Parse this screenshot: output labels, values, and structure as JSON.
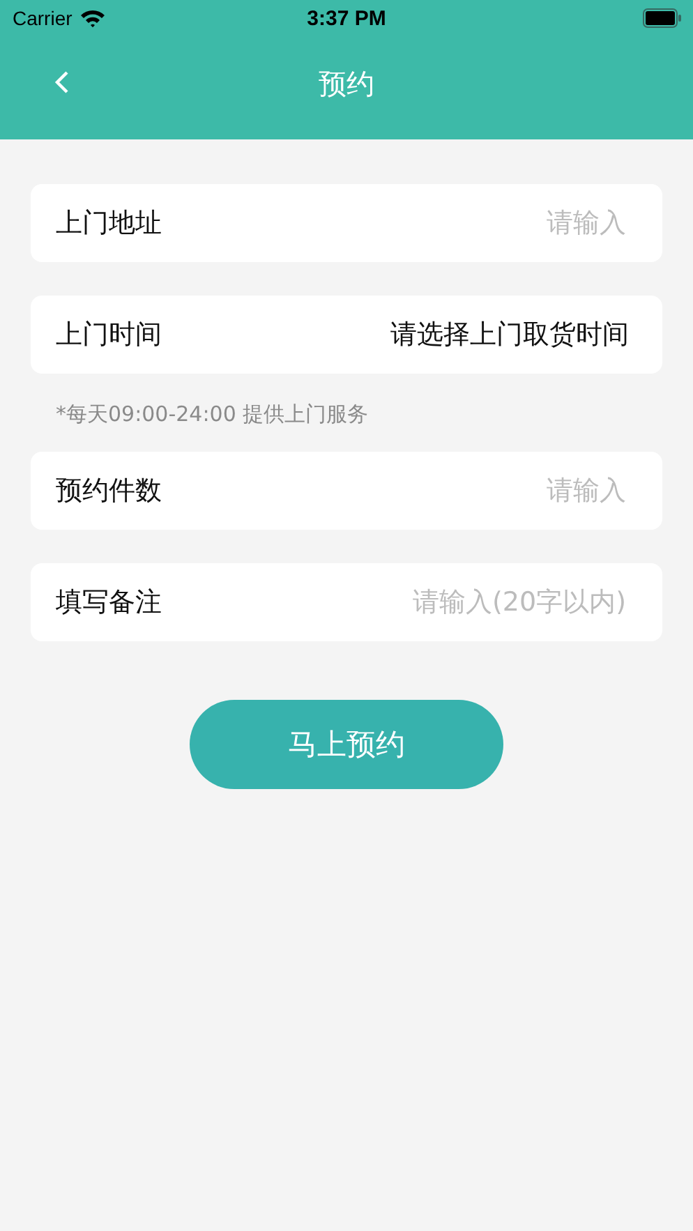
{
  "status_bar": {
    "carrier": "Carrier",
    "time": "3:37 PM"
  },
  "nav": {
    "title": "预约"
  },
  "fields": [
    {
      "label": "上门地址",
      "kind": "input",
      "placeholder": "请输入"
    },
    {
      "label": "上门时间",
      "kind": "select",
      "value": "请选择上门取货时间",
      "note": "*每天09:00-24:00 提供上门服务"
    },
    {
      "label": "预约件数",
      "kind": "input",
      "placeholder": "请输入"
    },
    {
      "label": "填写备注",
      "kind": "input",
      "placeholder": "请输入(20字以内)"
    }
  ],
  "submit_button": "马上预约"
}
